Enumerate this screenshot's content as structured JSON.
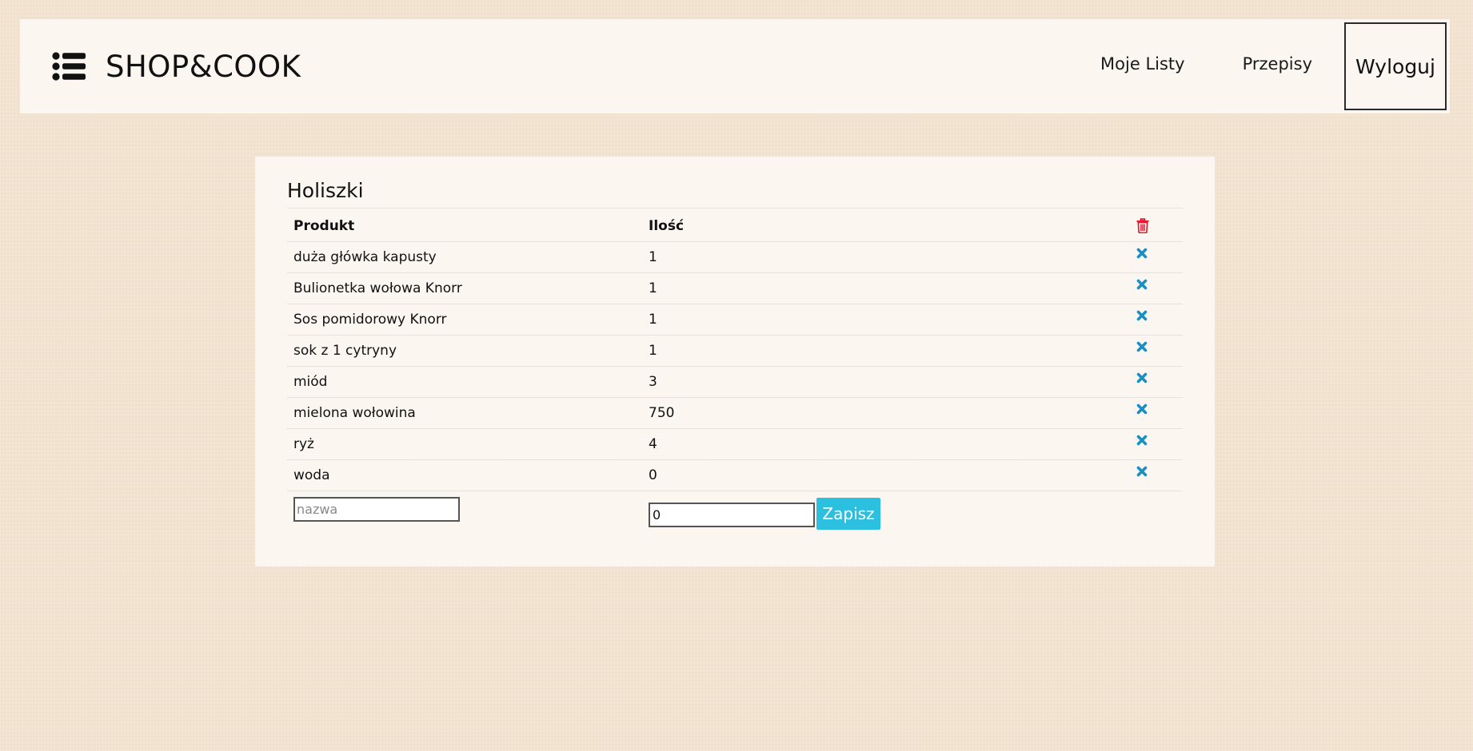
{
  "header": {
    "brand_title": "SHOP&COOK",
    "nav": {
      "my_lists": "Moje Listy",
      "recipes": "Przepisy",
      "logout": "Wyloguj"
    }
  },
  "list": {
    "title": "Holiszki",
    "columns": {
      "product": "Produkt",
      "quantity": "Ilość"
    },
    "items": [
      {
        "product": "duża główka kapusty",
        "quantity": "1"
      },
      {
        "product": "Bulionetka wołowa Knorr",
        "quantity": "1"
      },
      {
        "product": "Sos pomidorowy Knorr",
        "quantity": "1"
      },
      {
        "product": "sok z 1 cytryny",
        "quantity": "1"
      },
      {
        "product": "miód",
        "quantity": "3"
      },
      {
        "product": "mielona wołowina",
        "quantity": "750"
      },
      {
        "product": "ryż",
        "quantity": "4"
      },
      {
        "product": "woda",
        "quantity": "0"
      }
    ],
    "new_item": {
      "name_placeholder": "nazwa",
      "name_value": "",
      "quantity_value": "0",
      "save_label": "Zapisz"
    }
  },
  "colors": {
    "remove_icon": "#1a8fc4",
    "trash_icon": "#e0112b",
    "save_button": "#2bbfe0"
  }
}
